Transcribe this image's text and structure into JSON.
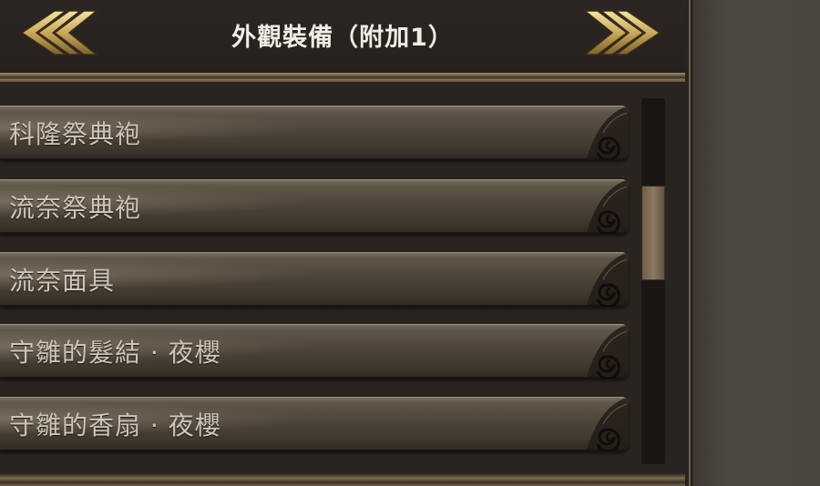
{
  "header": {
    "title": "外觀裝備（附加1）",
    "prev_icon": "double-chevron-left-icon",
    "next_icon": "double-chevron-right-icon"
  },
  "items": [
    {
      "label": "科隆祭典袍"
    },
    {
      "label": "流奈祭典袍"
    },
    {
      "label": "流奈面具"
    },
    {
      "label": "守雛的髮結 · 夜櫻"
    },
    {
      "label": "守雛的香扇 · 夜櫻"
    }
  ],
  "colors": {
    "gold": "#c9b27a",
    "label": "#cfc6b8",
    "title": "#f1ece4"
  }
}
